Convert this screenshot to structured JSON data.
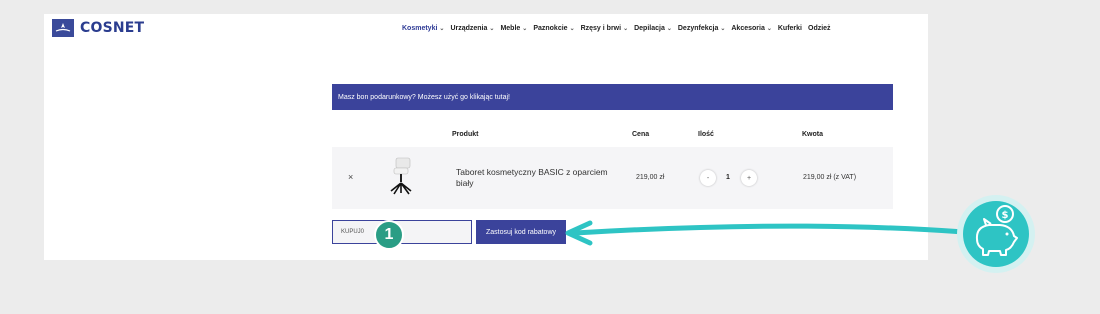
{
  "logo": {
    "text": "COSNET"
  },
  "nav": [
    {
      "label": "Kosmetyki",
      "caret": true,
      "active": true
    },
    {
      "label": "Urządzenia",
      "caret": true
    },
    {
      "label": "Meble",
      "caret": true
    },
    {
      "label": "Paznokcie",
      "caret": true
    },
    {
      "label": "Rzęsy i brwi",
      "caret": true
    },
    {
      "label": "Depilacja",
      "caret": true
    },
    {
      "label": "Dezynfekcja",
      "caret": true
    },
    {
      "label": "Akcesoria",
      "caret": true
    },
    {
      "label": "Kuferki",
      "caret": false
    },
    {
      "label": "Odzież",
      "caret": false
    }
  ],
  "gift_notice": "Masz bon podarunkowy? Możesz użyć go klikając tutaj!",
  "table": {
    "headers": {
      "product": "Produkt",
      "price": "Cena",
      "qty": "Ilość",
      "amount": "Kwota"
    },
    "row": {
      "remove": "×",
      "name": "Taboret kosmetyczny BASIC z oparciem biały",
      "price": "219,00 zł",
      "qty_minus": "-",
      "qty": "1",
      "qty_plus": "+",
      "amount": "219,00 zł (z VAT)"
    }
  },
  "coupon": {
    "value": "KUPUJ0",
    "button": "Zastosuj kod rabatowy"
  },
  "callout": {
    "number": "1"
  },
  "colors": {
    "brand": "#3b439b",
    "accent": "#2ec4c4",
    "badge": "#2a9d85"
  }
}
